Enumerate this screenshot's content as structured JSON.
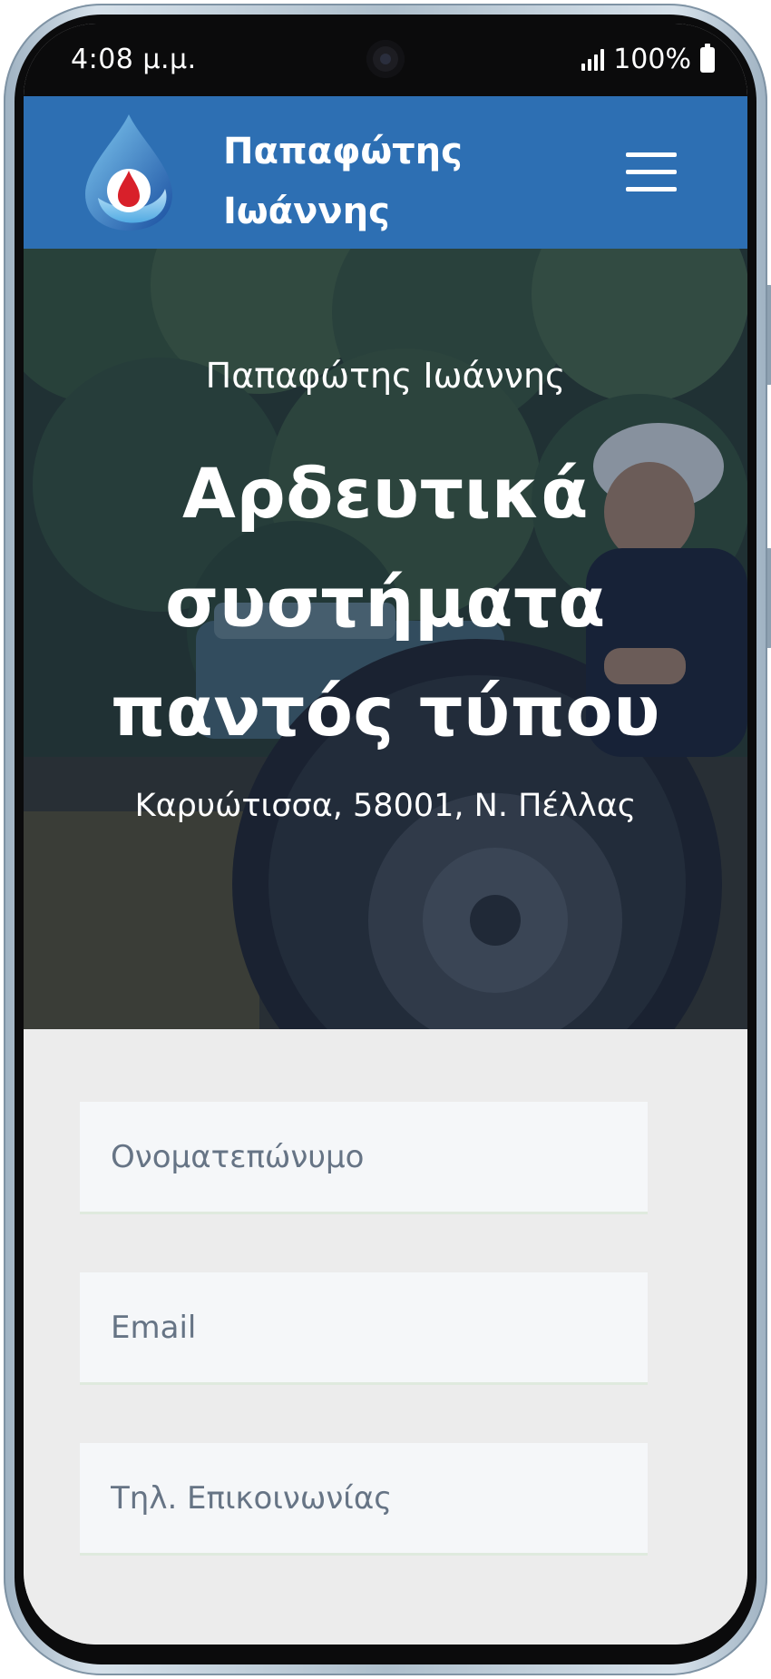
{
  "status_bar": {
    "time": "4:08 μ.μ.",
    "battery": "100%"
  },
  "header": {
    "brand_line1": "Παπαφώτης",
    "brand_line2": "Ιωάννης",
    "menu_icon": "hamburger-menu-icon",
    "color": "#2d6fb3"
  },
  "hero": {
    "subtitle": "Παπαφώτης Ιωάννης",
    "title_line1": "Αρδευτικά",
    "title_line2": "συστήματα",
    "title_line3": "παντός τύπου",
    "address": "Καρυώτισσα, 58001, Ν. Πέλλας"
  },
  "form": {
    "name_placeholder": "Ονοματεπώνυμο",
    "email_placeholder": "Email",
    "phone_placeholder": "Τηλ. Επικοινωνίας"
  }
}
